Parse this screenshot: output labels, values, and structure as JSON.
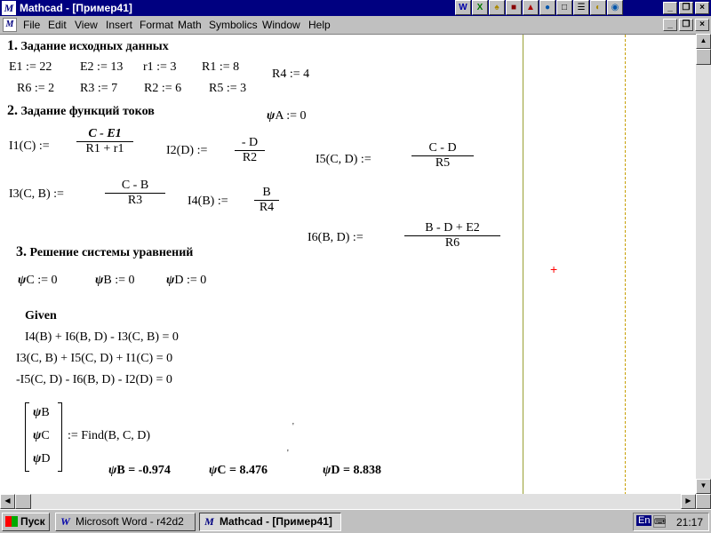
{
  "window": {
    "title": "Mathcad - [Пример41]",
    "app_icon": "M"
  },
  "toolbar_icons": [
    "W",
    "X",
    "♠",
    "■",
    "▲",
    "●",
    "□",
    "☰",
    "◐",
    "◉"
  ],
  "menu": [
    "File",
    "Edit",
    "View",
    "Insert",
    "Format",
    "Math",
    "Symbolics",
    "Window",
    "Help"
  ],
  "sections": {
    "s1_num": "1.",
    "s1_title": "Задание исходных данных",
    "s2_num": "2.",
    "s2_title": "Задание функций токов",
    "s3_num": "3.",
    "s3_title": "Решение системы уравнений"
  },
  "params": {
    "e1": "E1 := 22",
    "e2": "E2 := 13",
    "r1": "r1 := 3",
    "R1": "R1 := 8",
    "R4": "R4 := 4",
    "R6": "R6 := 2",
    "R3": "R3 := 7",
    "R2": "R2 := 6",
    "R5": "R5 := 3"
  },
  "ground": "A := 0",
  "funcs": {
    "I1_lhs": "I1(C) :=",
    "I1_num": "C - E1",
    "I1_den": "R1 + r1",
    "I2_lhs": "I2(D) :=",
    "I2_num": "- D",
    "I2_den": "R2",
    "I5_lhs": "I5(C, D) :=",
    "I5_num": "C - D",
    "I5_den": "R5",
    "I3_lhs": "I3(C, B) :=",
    "I3_num": "C - B",
    "I3_den": "R3",
    "I4_lhs": "I4(B) :=",
    "I4_num": "B",
    "I4_den": "R4",
    "I6_lhs": "I6(B, D) :=",
    "I6_num": "B - D + E2",
    "I6_den": "R6"
  },
  "initials": {
    "c": "C := 0",
    "b": "B := 0",
    "d": "D := 0"
  },
  "given": "Given",
  "equations": {
    "eq1": "I4(B) + I6(B, D) - I3(C, B) = 0",
    "eq2": "I3(C, B) + I5(C, D) + I1(C) = 0",
    "eq3": "-I5(C, D) - I6(B, D) - I2(D) = 0"
  },
  "find": {
    "vec": [
      "B",
      "C",
      "D"
    ],
    "expr": ":= Find(B, C, D)"
  },
  "results": {
    "b": "B = -0.974",
    "c": "C = 8.476",
    "d": "D = 8.838"
  },
  "taskbar": {
    "start": "Пуск",
    "task1": "Microsoft Word - r42d2",
    "task2": "Mathcad - [Пример41]",
    "lang": "En",
    "clock": "21:17"
  },
  "colors": {
    "titlebar": "#000080",
    "margin_line": "#99a033",
    "page_line": "#c8a000",
    "crosshair": "#ff0000"
  }
}
